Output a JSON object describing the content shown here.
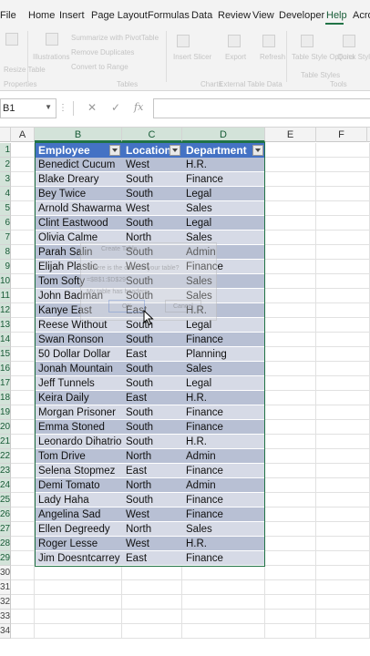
{
  "menu": [
    "File",
    "Home",
    "Insert",
    "Page Layout",
    "Formulas",
    "Data",
    "Review",
    "View",
    "Developer",
    "Help",
    "Acro"
  ],
  "active_menu": "Help",
  "ribbon": {
    "labels": [
      "Summarize with PivotTable",
      "Remove Duplicates",
      "Convert to Range",
      "Insert Slicer",
      "Export",
      "Refresh",
      "Table Style Options",
      "Quick Styles",
      "Tools",
      "External Table Data",
      "Table Styles",
      "Properties",
      "Illustrations",
      "Charts",
      "Tables",
      "Resize Table"
    ]
  },
  "formula_bar": {
    "name_box": "B1",
    "name_box_caret": "▼",
    "overflow": "⋮",
    "cancel_symbol": "✕",
    "enter_symbol": "✓",
    "fx_symbol": "fx",
    "formula": ""
  },
  "columns": [
    "A",
    "B",
    "C",
    "D",
    "E",
    "F"
  ],
  "selected_columns": [
    "B",
    "C",
    "D"
  ],
  "row_numbers": [
    "1",
    "2",
    "3",
    "4",
    "5",
    "6",
    "7",
    "8",
    "9",
    "10",
    "11",
    "12",
    "13",
    "14",
    "15",
    "16",
    "17",
    "18",
    "19",
    "20",
    "21",
    "22",
    "23",
    "24",
    "25",
    "26",
    "27",
    "28",
    "29",
    "30",
    "31",
    "32",
    "33",
    "34"
  ],
  "table": {
    "headers": [
      "Employee",
      "Location",
      "Department"
    ],
    "rows": [
      [
        "Benedict Cucum",
        "West",
        "H.R."
      ],
      [
        "Blake Dreary",
        "South",
        "Finance"
      ],
      [
        "Bey Twice",
        "South",
        "Legal"
      ],
      [
        "Arnold Shawarma",
        "West",
        "Sales"
      ],
      [
        "Clint Eastwood",
        "South",
        "Legal"
      ],
      [
        "Olivia Calme",
        "North",
        "Sales"
      ],
      [
        "Parah Salin",
        "South",
        "Admin"
      ],
      [
        "Elijah Plastic",
        "West",
        "Finance"
      ],
      [
        "Tom Softy",
        "South",
        "Sales"
      ],
      [
        "John Badman",
        "South",
        "Sales"
      ],
      [
        "Kanye East",
        "East",
        "H.R."
      ],
      [
        "Reese Without",
        "South",
        "Legal"
      ],
      [
        "Swan Ronson",
        "South",
        "Finance"
      ],
      [
        "50 Dollar Dollar",
        "East",
        "Planning"
      ],
      [
        "Jonah Mountain",
        "South",
        "Sales"
      ],
      [
        "Jeff Tunnels",
        "South",
        "Legal"
      ],
      [
        "Keira Daily",
        "East",
        "H.R."
      ],
      [
        "Morgan Prisoner",
        "South",
        "Finance"
      ],
      [
        "Emma Stoned",
        "South",
        "Finance"
      ],
      [
        "Leonardo Dihatrio",
        "South",
        "H.R."
      ],
      [
        "Tom Drive",
        "North",
        "Admin"
      ],
      [
        "Selena Stopmez",
        "East",
        "Finance"
      ],
      [
        "Demi Tomato",
        "North",
        "Admin"
      ],
      [
        "Lady Haha",
        "South",
        "Finance"
      ],
      [
        "Angelina Sad",
        "West",
        "Finance"
      ],
      [
        "Ellen Degreedy",
        "North",
        "Sales"
      ],
      [
        "Roger Lesse",
        "West",
        "H.R."
      ],
      [
        "Jim Doesntcarrey",
        "East",
        "Finance"
      ]
    ]
  },
  "ghost_dialog": {
    "title": "Create Table",
    "prompt": "Where is the data for your table?",
    "range": "=$B$1:$D$29",
    "checkbox": "My table has headers",
    "ok": "OK",
    "cancel": "Cancel"
  },
  "colors": {
    "header_blue": "#4472c4",
    "band_dark": "#b8c0d4",
    "band_light": "#d6dae6",
    "excel_green": "#217346"
  }
}
